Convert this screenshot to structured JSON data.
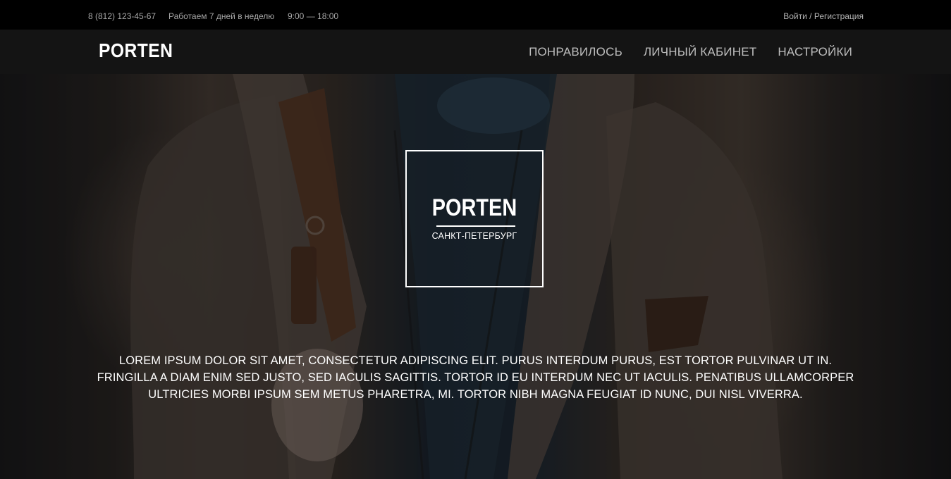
{
  "topbar": {
    "phone": "8 (812) 123-45-67",
    "days": "Работаем 7 дней в неделю",
    "hours": "9:00 — 18:00",
    "login": "Войти",
    "separator": " / ",
    "register": "Регистрация"
  },
  "header": {
    "logo": "PORTEN",
    "nav": [
      {
        "label": "ПОНРАВИЛОСЬ"
      },
      {
        "label": "ЛИЧНЫЙ КАБИНЕТ"
      },
      {
        "label": "НАСТРОЙКИ"
      }
    ]
  },
  "hero": {
    "brand": "PORTEN",
    "city": "САНКТ-ПЕТЕРБУРГ",
    "text": "LOREM IPSUM DOLOR SIT AMET, CONSECTETUR ADIPISCING ELIT. PURUS INTERDUM PURUS, EST TORTOR PULVINAR UT IN. FRINGILLA A DIAM ENIM SED JUSTO, SED IACULIS SAGITTIS. TORTOR ID EU INTERDUM NEC UT IACULIS. PENATIBUS ULLAMCORPER ULTRICIES MORBI IPSUM SEM METUS PHARETRA, MI. TORTOR NIBH MAGNA FEUGIAT ID NUNC, DUI NISL VIVERRA."
  },
  "colors": {
    "topbar_bg": "#000000",
    "header_bg": "#141414",
    "nav_text": "#bdbdbd",
    "topbar_text": "#a6a6a6",
    "hero_text": "#ffffff"
  }
}
